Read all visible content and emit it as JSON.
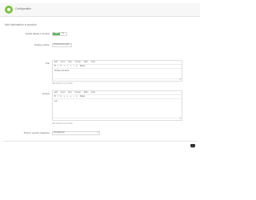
{
  "header": {
    "title": "Configuration"
  },
  "section": {
    "title": "Add information in product"
  },
  "fields": {
    "enable_label": "Enable display in product",
    "toggle_on": "YES",
    "toggle_off": "NO",
    "position_label": "Display position",
    "position_value": "Product Extra right",
    "title_label": "Title",
    "title_value": "Product info block",
    "content_label": "Content",
    "content_value": "test",
    "custom_label": "Show in specific categories",
    "custom_value": "All categories"
  },
  "editor": {
    "menu": [
      "Edit",
      "Insert",
      "View",
      "Format",
      "Table",
      "Tools"
    ],
    "toolbar": [
      "B",
      "I",
      "U",
      "≡",
      "≡",
      "≡",
      "•",
      "1.",
      "Styles"
    ],
    "help": "Add content in your block"
  },
  "footer": {
    "save_label": "Save"
  },
  "colors": {
    "accent": "#7bc241",
    "toggle_on": "#5cb85c"
  }
}
